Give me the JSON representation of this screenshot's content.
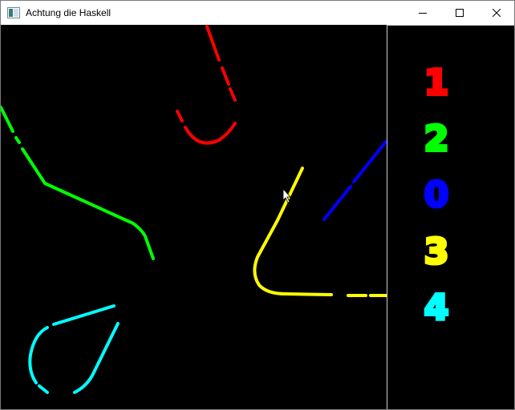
{
  "window": {
    "title": "Achtung die Haskell",
    "controls": {
      "minimize": "minimize-icon",
      "maximize": "maximize-icon",
      "close": "close-icon"
    }
  },
  "players": [
    {
      "color": "#ff0000",
      "score": "1"
    },
    {
      "color": "#00ff00",
      "score": "2"
    },
    {
      "color": "#0000ff",
      "score": "0"
    },
    {
      "color": "#ffff00",
      "score": "3"
    },
    {
      "color": "#00ffff",
      "score": "4"
    }
  ],
  "cursor": "mouse-pointer-icon"
}
